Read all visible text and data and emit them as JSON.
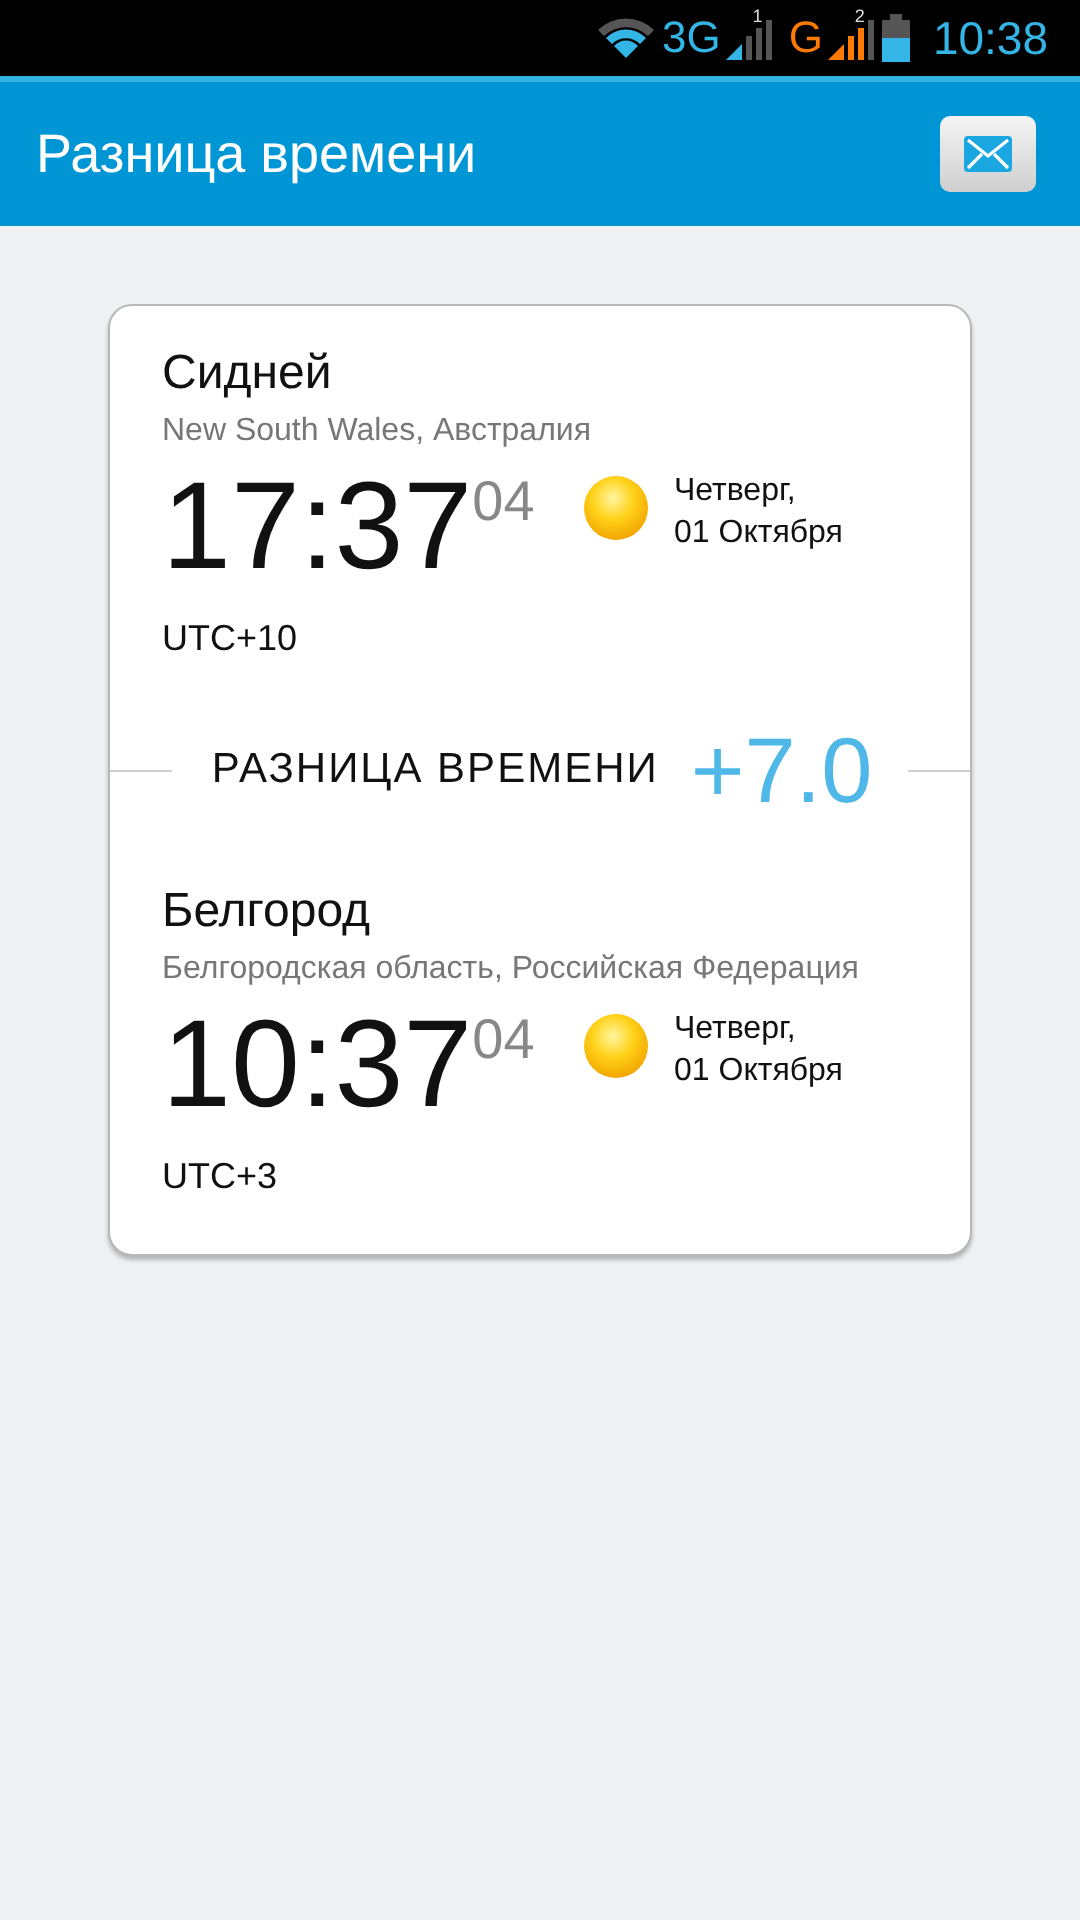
{
  "status_bar": {
    "network_1": "3G",
    "sim_1": "1",
    "network_2": "G",
    "sim_2": "2",
    "time": "10:38"
  },
  "app_bar": {
    "title": "Разница времени"
  },
  "places": [
    {
      "city": "Сидней",
      "region": "New South Wales, Австралия",
      "time": "17:37",
      "seconds": "04",
      "weekday": "Четверг,",
      "date": "01 Октября",
      "utc": "UTC+10"
    },
    {
      "city": "Белгород",
      "region": "Белгородская область, Российская Федерация",
      "time": "10:37",
      "seconds": "04",
      "weekday": "Четверг,",
      "date": "01 Октября",
      "utc": "UTC+3"
    }
  ],
  "difference": {
    "label": "РАЗНИЦА ВРЕМЕНИ",
    "value": "+7.0"
  }
}
